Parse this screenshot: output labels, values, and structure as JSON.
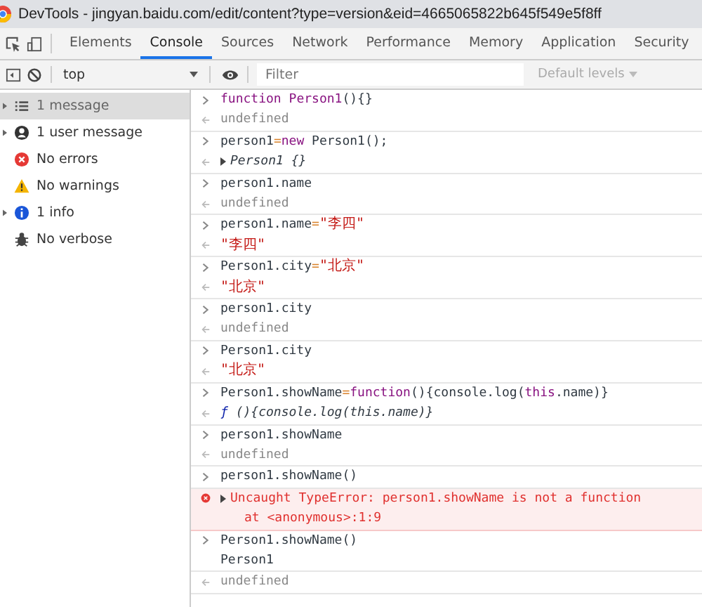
{
  "window": {
    "title": "DevTools - jingyan.baidu.com/edit/content?type=version&eid=4665065822b645f549e5f8ff"
  },
  "tabs": [
    {
      "label": "Elements",
      "selected": false
    },
    {
      "label": "Console",
      "selected": true
    },
    {
      "label": "Sources",
      "selected": false
    },
    {
      "label": "Network",
      "selected": false
    },
    {
      "label": "Performance",
      "selected": false
    },
    {
      "label": "Memory",
      "selected": false
    },
    {
      "label": "Application",
      "selected": false
    },
    {
      "label": "Security",
      "selected": false
    }
  ],
  "toolbar": {
    "context": "top",
    "filter": {
      "placeholder": "Filter"
    },
    "levels": "Default levels"
  },
  "sidebar": {
    "items": [
      {
        "kind": "list",
        "label": "1 message",
        "expandable": true,
        "selected": true
      },
      {
        "kind": "user",
        "label": "1 user message",
        "expandable": true,
        "selected": false
      },
      {
        "kind": "error",
        "label": "No errors",
        "expandable": false,
        "selected": false
      },
      {
        "kind": "warning",
        "label": "No warnings",
        "expandable": false,
        "selected": false
      },
      {
        "kind": "info",
        "label": "1 info",
        "expandable": true,
        "selected": false
      },
      {
        "kind": "bug",
        "label": "No verbose",
        "expandable": false,
        "selected": false
      }
    ]
  },
  "console": [
    {
      "lines": [
        {
          "kind": "input",
          "tokens": [
            {
              "text": "function ",
              "kind": "keyword"
            },
            {
              "text": "Person1",
              "kind": "name"
            },
            {
              "text": "(){}",
              "kind": "plain"
            }
          ]
        },
        {
          "kind": "result",
          "tokens": [
            {
              "text": "undefined",
              "kind": "gray"
            }
          ]
        }
      ]
    },
    {
      "lines": [
        {
          "kind": "input",
          "tokens": [
            {
              "text": "person1",
              "kind": "plain"
            },
            {
              "text": "=",
              "kind": "op"
            },
            {
              "text": "new",
              "kind": "keyword"
            },
            {
              "text": " Person1();",
              "kind": "plain"
            }
          ]
        },
        {
          "kind": "result",
          "expandable": true,
          "tokens": [
            {
              "text": "Person1 {}",
              "kind": "italic"
            }
          ]
        }
      ]
    },
    {
      "lines": [
        {
          "kind": "input",
          "tokens": [
            {
              "text": "person1.name",
              "kind": "plain"
            }
          ]
        },
        {
          "kind": "result",
          "tokens": [
            {
              "text": "undefined",
              "kind": "gray"
            }
          ]
        }
      ]
    },
    {
      "lines": [
        {
          "kind": "input",
          "tokens": [
            {
              "text": "person1.name",
              "kind": "plain"
            },
            {
              "text": "=",
              "kind": "op"
            },
            {
              "text": "\"李四\"",
              "kind": "string"
            }
          ]
        },
        {
          "kind": "result",
          "tokens": [
            {
              "text": "\"李四\"",
              "kind": "string"
            }
          ]
        }
      ]
    },
    {
      "lines": [
        {
          "kind": "input",
          "tokens": [
            {
              "text": "Person1.city",
              "kind": "plain"
            },
            {
              "text": "=",
              "kind": "op"
            },
            {
              "text": "\"北京\"",
              "kind": "string"
            }
          ]
        },
        {
          "kind": "result",
          "tokens": [
            {
              "text": "\"北京\"",
              "kind": "string"
            }
          ]
        }
      ]
    },
    {
      "lines": [
        {
          "kind": "input",
          "tokens": [
            {
              "text": "person1.city",
              "kind": "plain"
            }
          ]
        },
        {
          "kind": "result",
          "tokens": [
            {
              "text": "undefined",
              "kind": "gray"
            }
          ]
        }
      ]
    },
    {
      "lines": [
        {
          "kind": "input",
          "tokens": [
            {
              "text": "Person1.city",
              "kind": "plain"
            }
          ]
        },
        {
          "kind": "result",
          "tokens": [
            {
              "text": "\"北京\"",
              "kind": "string"
            }
          ]
        }
      ]
    },
    {
      "lines": [
        {
          "kind": "input",
          "tokens": [
            {
              "text": "Person1.showName",
              "kind": "plain"
            },
            {
              "text": "=",
              "kind": "op"
            },
            {
              "text": "function",
              "kind": "keyword"
            },
            {
              "text": "(){console.log(",
              "kind": "plain"
            },
            {
              "text": "this",
              "kind": "keyword"
            },
            {
              "text": ".name)}",
              "kind": "plain"
            }
          ]
        },
        {
          "kind": "result",
          "tokens": [
            {
              "text": "ƒ",
              "kind": "fn"
            },
            {
              "text": " (){console.log(this.name)}",
              "kind": "italic"
            }
          ]
        }
      ]
    },
    {
      "lines": [
        {
          "kind": "input",
          "tokens": [
            {
              "text": "person1.showName",
              "kind": "plain"
            }
          ]
        },
        {
          "kind": "result",
          "tokens": [
            {
              "text": "undefined",
              "kind": "gray"
            }
          ]
        }
      ]
    },
    {
      "lines": [
        {
          "kind": "input",
          "tokens": [
            {
              "text": "person1.showName()",
              "kind": "plain"
            }
          ]
        }
      ]
    },
    {
      "lines": [
        {
          "kind": "error",
          "expandable": true,
          "tokens": [
            {
              "text": "Uncaught TypeError: person1.showName is not a function",
              "kind": "plain"
            }
          ],
          "detail": "at <anonymous>:1:9"
        }
      ]
    },
    {
      "lines": [
        {
          "kind": "input",
          "tokens": [
            {
              "text": "Person1.showName()",
              "kind": "plain"
            }
          ]
        },
        {
          "kind": "log",
          "tokens": [
            {
              "text": "Person1",
              "kind": "plain"
            }
          ]
        }
      ]
    },
    {
      "lines": [
        {
          "kind": "result",
          "tokens": [
            {
              "text": "undefined",
              "kind": "gray"
            }
          ]
        }
      ]
    }
  ]
}
